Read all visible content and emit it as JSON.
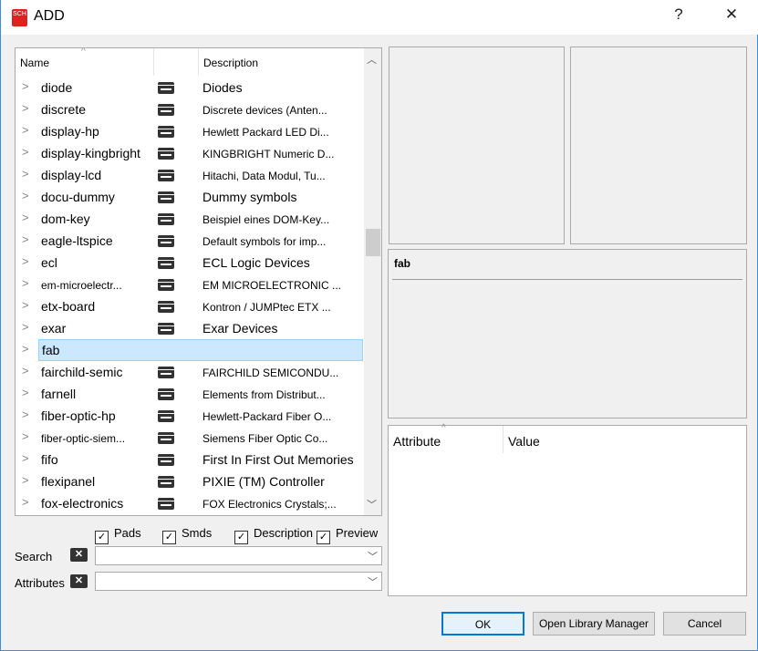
{
  "window": {
    "title": "ADD",
    "help": "?",
    "close": "✕",
    "icon_text": "SCH"
  },
  "list": {
    "headers": {
      "name": "Name",
      "description": "Description"
    },
    "rows": [
      {
        "name": "diode",
        "description": "Diodes"
      },
      {
        "name": "discrete",
        "description": "Discrete devices (Anten..."
      },
      {
        "name": "display-hp",
        "description": "Hewlett Packard LED Di..."
      },
      {
        "name": "display-kingbright",
        "description": "KINGBRIGHT Numeric D..."
      },
      {
        "name": "display-lcd",
        "description": "Hitachi, Data Modul, Tu..."
      },
      {
        "name": "docu-dummy",
        "description": "Dummy symbols"
      },
      {
        "name": "dom-key",
        "description": "Beispiel eines DOM-Key..."
      },
      {
        "name": "eagle-ltspice",
        "description": "Default symbols for imp..."
      },
      {
        "name": "ecl",
        "description": "ECL Logic Devices"
      },
      {
        "name": "em-microelectr...",
        "description": "EM MICROELECTRONIC ..."
      },
      {
        "name": "etx-board",
        "description": "Kontron / JUMPtec ETX ..."
      },
      {
        "name": "exar",
        "description": "Exar Devices"
      },
      {
        "name": "fab",
        "description": ""
      },
      {
        "name": "fairchild-semic",
        "description": "FAIRCHILD SEMICONDU..."
      },
      {
        "name": "farnell",
        "description": "Elements from Distribut..."
      },
      {
        "name": "fiber-optic-hp",
        "description": "Hewlett-Packard Fiber O..."
      },
      {
        "name": "fiber-optic-siem...",
        "description": "Siemens Fiber Optic Co..."
      },
      {
        "name": "fifo",
        "description": "First In First Out Memories"
      },
      {
        "name": "flexipanel",
        "description": "PIXIE (TM) Controller"
      },
      {
        "name": "fox-electronics",
        "description": "FOX Electronics Crystals;..."
      }
    ]
  },
  "options": {
    "pads": "Pads",
    "smds": "Smds",
    "description": "Description",
    "preview": "Preview"
  },
  "search": {
    "label": "Search",
    "value": ""
  },
  "attributes": {
    "label": "Attributes",
    "value": ""
  },
  "info": {
    "title": "fab"
  },
  "attr_table": {
    "attribute": "Attribute",
    "value": "Value"
  },
  "buttons": {
    "ok": "OK",
    "manager": "Open Library Manager",
    "cancel": "Cancel"
  }
}
